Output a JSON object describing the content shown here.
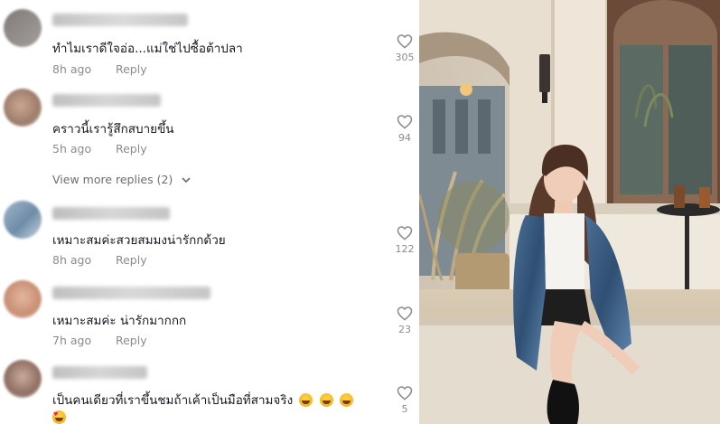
{
  "comments": [
    {
      "text": "ทำไมเราดีใจอ่อ...แม่ใช่ไปซื้อต้าปลา",
      "time": "8h ago",
      "reply": "Reply",
      "likes": "305"
    },
    {
      "text": "คราวนี้เรารู้สึกสบายขึ้น",
      "time": "5h ago",
      "reply": "Reply",
      "likes": "94"
    },
    {
      "text": "เหมาะสมค่ะสวยสมมงน่ารักกด้วย",
      "time": "8h ago",
      "reply": "Reply",
      "likes": "122"
    },
    {
      "text": "เหมาะสมค่ะ น่ารักมากกก",
      "time": "7h ago",
      "reply": "Reply",
      "likes": "23"
    },
    {
      "text": "เป็นคนเดียวที่เราขึ้นชมถ้าเค้าเป็นมือที่สามจริง",
      "likes": "5"
    }
  ],
  "view_more": "View more replies (2)",
  "icons": {
    "like": "heart-outline-icon",
    "expand": "chevron-down-icon",
    "emoji_laugh": "laughing-tears-emoji",
    "emoji_love": "heart-eyes-emoji"
  },
  "colors": {
    "text": "#161823",
    "muted": "#8a8b91"
  }
}
